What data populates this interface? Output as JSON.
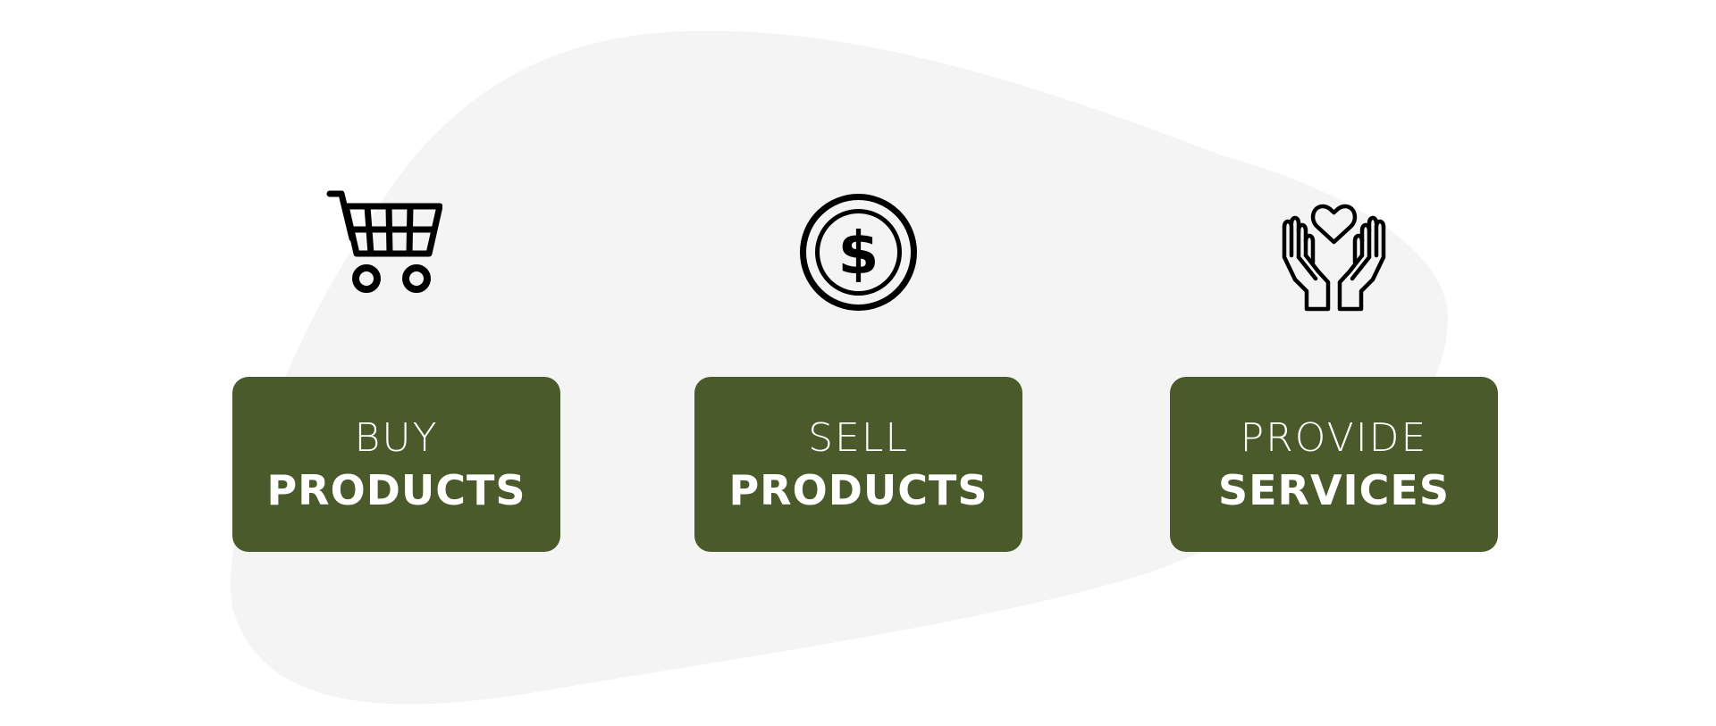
{
  "colors": {
    "background": "#ffffff",
    "blob": "#f4f4f4",
    "card": "#4a5a2a",
    "card_text": "#ffffff",
    "icon": "#000000"
  },
  "items": [
    {
      "icon": "shopping-cart-icon",
      "line1": "BUY",
      "line2": "PRODUCTS"
    },
    {
      "icon": "dollar-coin-icon",
      "line1": "SELL",
      "line2": "PRODUCTS"
    },
    {
      "icon": "hands-heart-icon",
      "line1": "PROVIDE",
      "line2": "SERVICES"
    }
  ]
}
